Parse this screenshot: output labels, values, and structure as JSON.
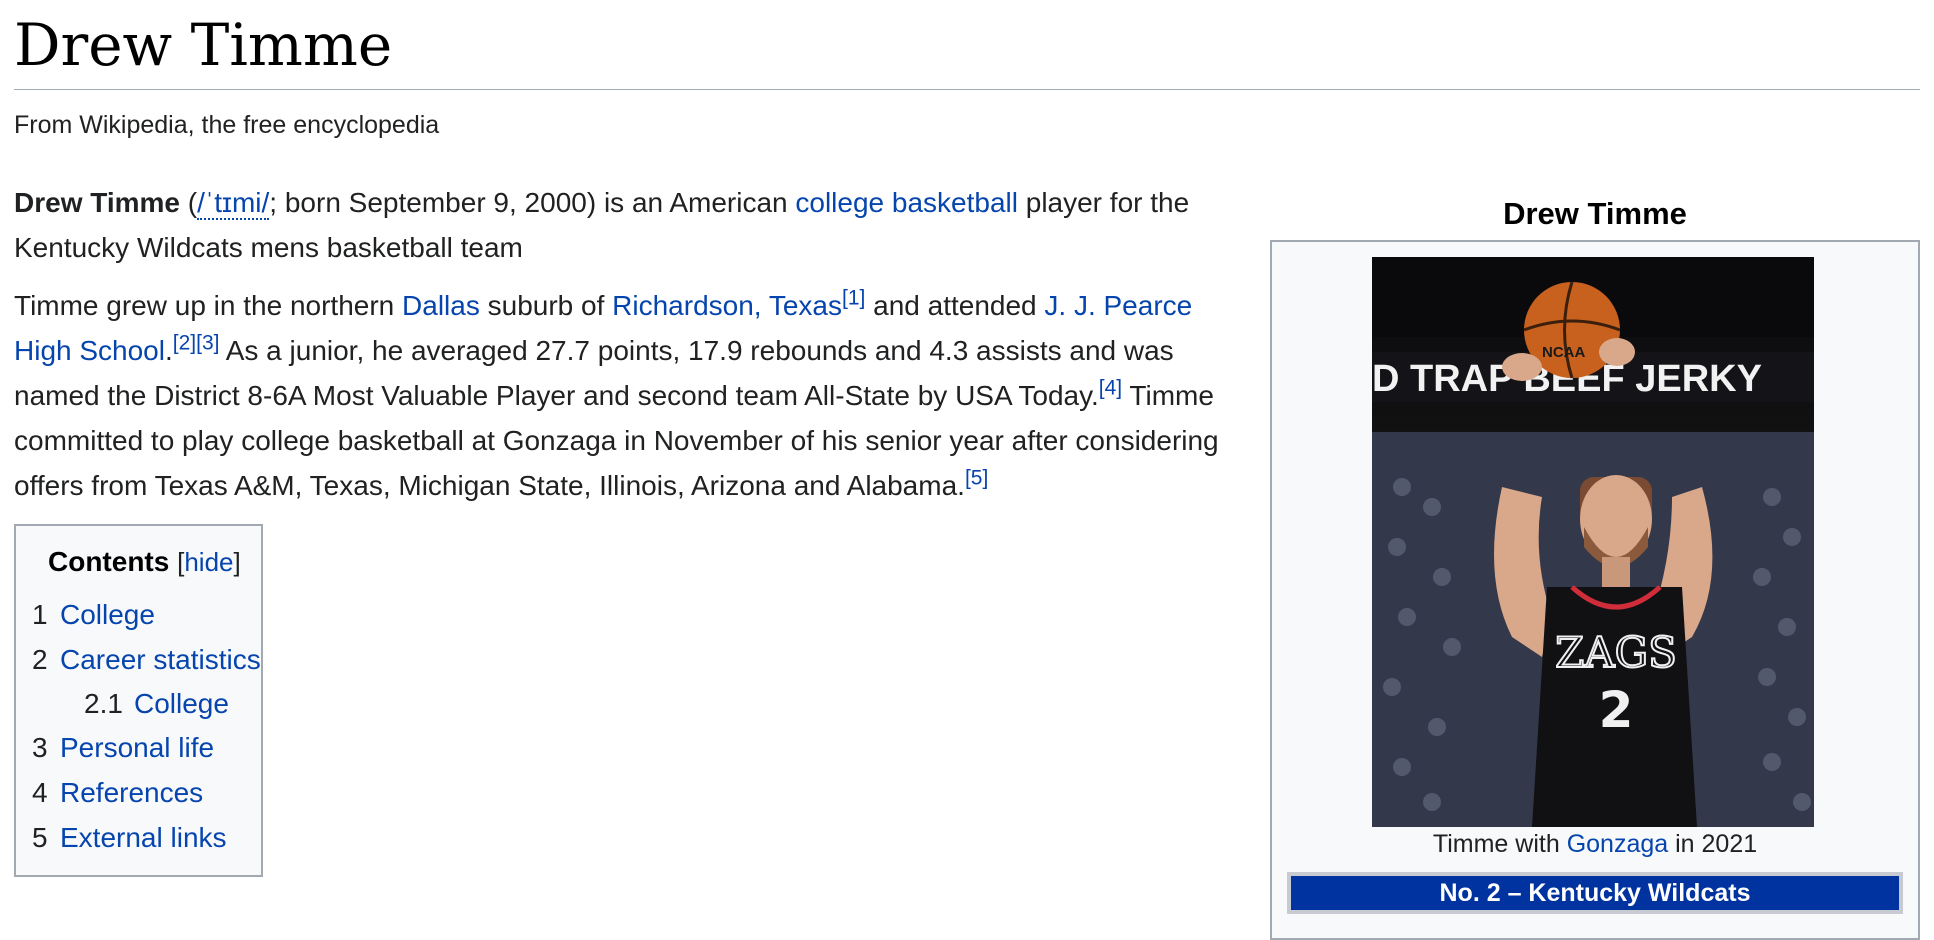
{
  "page": {
    "title": "Drew Timme",
    "tagline": "From Wikipedia, the free encyclopedia"
  },
  "intro": {
    "name_bold": "Drew Timme",
    "paren_open": " (",
    "ipa": "/ˈtɪmi/",
    "after_ipa": "; born September 9, 2000) is an American ",
    "link_college_basketball": "college basketball",
    "rest": " player for the Kentucky Wildcats mens basketball team"
  },
  "paragraph2": {
    "t1": "Timme grew up in the northern ",
    "link_dallas": "Dallas",
    "t2": " suburb of ",
    "link_richardson": "Richardson, Texas",
    "ref1": "[1]",
    "t3": " and attended ",
    "link_pearce": "J. J. Pearce High School",
    "t4": ".",
    "ref2": "[2]",
    "ref3": "[3]",
    "t5": " As a junior, he averaged 27.7 points, 17.9 rebounds and 4.3 assists and was named the District 8-6A Most Valuable Player and second team All-State by USA Today.",
    "ref4": "[4]",
    "t6": " Timme committed to play college basketball at Gonzaga in November of his senior year after considering offers from Texas A&M, Texas, Michigan State, Illinois, Arizona and Alabama.",
    "ref5": "[5]"
  },
  "toc": {
    "title": "Contents",
    "bracket_open": "[",
    "hide": "hide",
    "bracket_close": "]",
    "items": [
      {
        "num": "1",
        "label": "College"
      },
      {
        "num": "2",
        "label": "Career statistics"
      },
      {
        "num": "2.1",
        "label": "College"
      },
      {
        "num": "3",
        "label": "Personal life"
      },
      {
        "num": "4",
        "label": "References"
      },
      {
        "num": "5",
        "label": "External links"
      }
    ]
  },
  "infobox": {
    "title": "Drew Timme",
    "photo_banner": "D TRAP   BEEF JERKY",
    "jersey_text": "ZAGS",
    "jersey_number": "2",
    "ball_text": "NCAA",
    "caption_pre": "Timme with ",
    "caption_link": "Gonzaga",
    "caption_post": " in 2021",
    "team_header": "No. 2 – Kentucky Wildcats"
  },
  "colors": {
    "link": "#0645ad",
    "team_bar": "#0033a0",
    "border": "#a2a9b1"
  }
}
